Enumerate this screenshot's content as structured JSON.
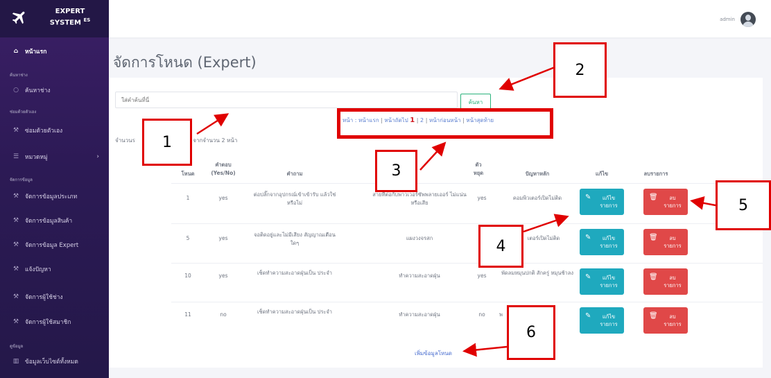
{
  "brand": {
    "line1": "EXPERT",
    "line2": "SYSTEM",
    "sup": "ES"
  },
  "sidebar": {
    "items": [
      {
        "label": "หน้าแรก",
        "icon": "home-icon",
        "active": true
      },
      {
        "label": "ค้นหาช่าง",
        "icon": "search-icon"
      },
      {
        "label": "ซ่อมด้วยตัวเอง",
        "icon": "wrench-icon"
      },
      {
        "label": "หมวดหมู่",
        "icon": "list-icon"
      },
      {
        "label": "จัดการข้อมูลประเภท",
        "icon": "wrench-icon"
      },
      {
        "label": "จัดการข้อมูลสินค้า",
        "icon": "wrench-icon"
      },
      {
        "label": "จัดการข้อมูล Expert",
        "icon": "wrench-icon"
      },
      {
        "label": "แจ้งปัญหา",
        "icon": "wrench-icon"
      },
      {
        "label": "จัดการผู้ใช้ช่าง",
        "icon": "wrench-icon"
      },
      {
        "label": "จัดการผู้ใช้สมาชิก",
        "icon": "wrench-icon"
      },
      {
        "label": "ข้อมูลเว็บไซต์ทั้งหมด",
        "icon": "chart-icon"
      }
    ],
    "sections": [
      "ค้นหาช่าง",
      "ซ่อมด้วยตัวเอง",
      "จัดการข้อมูล",
      "ดูข้อมูล"
    ]
  },
  "topbar": {
    "user": "admin"
  },
  "page": {
    "title": "จัดการโหนด (Expert)"
  },
  "search": {
    "placeholder": "ใส่คำค้นที่นี่",
    "button": "ค้นหา"
  },
  "pager": {
    "prefix": "หน้า :",
    "first": "หน้าแรก",
    "next": "หน้าถัดไป",
    "current": "1",
    "page2": "2",
    "prev": "หน้าก่อนหน้า",
    "last": "หน้าสุดท้าย"
  },
  "count": {
    "prefix": "จำนวนร",
    "suffix": "ายการ จากจำนวน 2 หน้า"
  },
  "table": {
    "headers": {
      "node": "โหนด",
      "answer": "คำตอบ (Yes/No)",
      "question": "คำถาม",
      "stop": "ตัว หยุด",
      "problem": "ปัญหาหลัก",
      "edit": "แก้ไข",
      "delete": "ลบรายการ"
    },
    "rows": [
      {
        "node": "1",
        "answer": "yes",
        "question": "ต่อปลั๊กจากอุปกรณ์เข้าเข้ารับ แล้วใช่หรือไม่",
        "solution": "สายที่ต่อกับพาวเวอร์ซัพพลายเออร์ ไม่แน่นหรือเสีย",
        "stop": "yes",
        "problem": "คอมพิวเตอร์เปิดไม่ติด"
      },
      {
        "node": "5",
        "answer": "yes",
        "question": "จอติดอยู่และไม่มีเสียง สัญญาณเตือนใดๆ",
        "solution": "แผงวงจรสก",
        "stop": "",
        "problem": "เตอร์เปิดไม่ติด"
      },
      {
        "node": "10",
        "answer": "yes",
        "question": "เช็ดทำความสะอาดฝุ่นเป็น ประจำ",
        "solution": "ทำความสะอาดฝุ่น",
        "stop": "yes",
        "problem": "พัดลมหมุนปกติ สักครู่ หมุนช้าลง"
      },
      {
        "node": "11",
        "answer": "no",
        "question": "เช็ดทำความสะอาดฝุ่นเป็น ประจำ",
        "solution": "ทำความสะอาดฝุ่น",
        "stop": "no",
        "problem": "พ"
      }
    ],
    "edit_label": [
      "แก้ไข",
      "รายการ"
    ],
    "delete_label": [
      "ลบ",
      "รายการ"
    ],
    "add_link": "เพิ่มข้อมูลโหนด"
  },
  "annotations": [
    "1",
    "2",
    "3",
    "4",
    "5",
    "6"
  ],
  "colors": {
    "annotation": "#e00000",
    "edit": "#1fa9be",
    "delete": "#e04848",
    "sidebar": "#2c1a55"
  }
}
